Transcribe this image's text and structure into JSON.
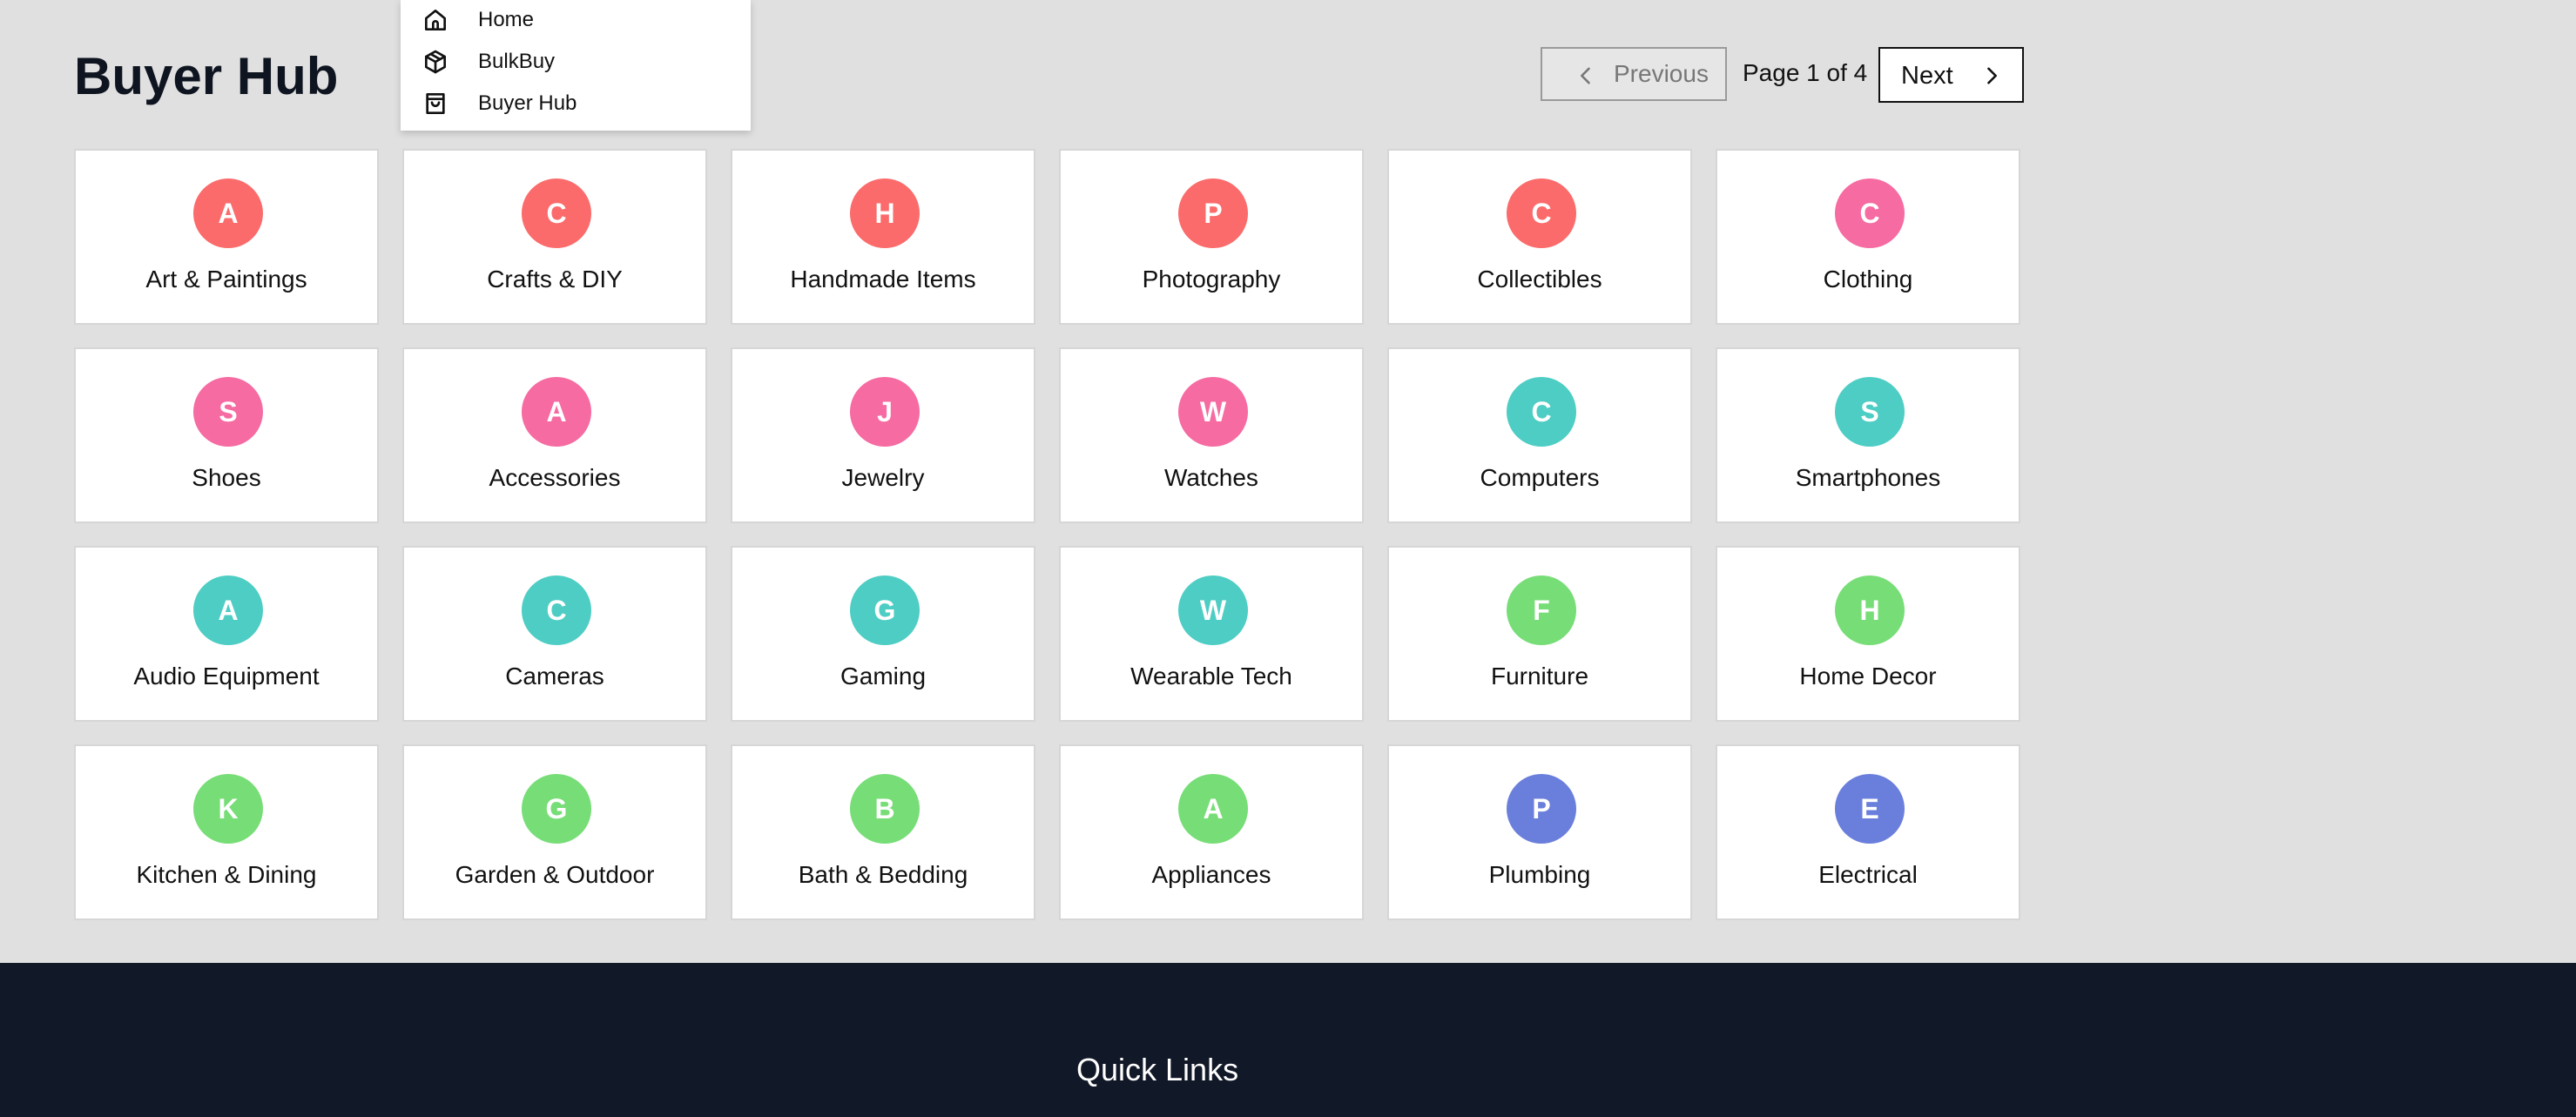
{
  "page": {
    "title": "Buyer Hub"
  },
  "nav_menu": {
    "items": [
      {
        "label": "Home",
        "icon": "home-icon"
      },
      {
        "label": "BulkBuy",
        "icon": "box-icon"
      },
      {
        "label": "Buyer Hub",
        "icon": "shopping-bag-icon"
      }
    ]
  },
  "pagination": {
    "previous_label": "Previous",
    "page_info": "Page 1 of 4",
    "next_label": "Next",
    "current_page": 1,
    "total_pages": 4
  },
  "colors": {
    "red": "#fb6b6b",
    "pink": "#f56ba2",
    "teal": "#4ecdc4",
    "green": "#77dd77",
    "indigo": "#6a7fdb",
    "footer": "#111827"
  },
  "categories": [
    {
      "initial": "A",
      "name": "Art & Paintings",
      "color": "#fb6b6b"
    },
    {
      "initial": "C",
      "name": "Crafts & DIY",
      "color": "#fb6b6b"
    },
    {
      "initial": "H",
      "name": "Handmade Items",
      "color": "#fb6b6b"
    },
    {
      "initial": "P",
      "name": "Photography",
      "color": "#fb6b6b"
    },
    {
      "initial": "C",
      "name": "Collectibles",
      "color": "#fb6b6b"
    },
    {
      "initial": "C",
      "name": "Clothing",
      "color": "#f56ba2"
    },
    {
      "initial": "S",
      "name": "Shoes",
      "color": "#f56ba2"
    },
    {
      "initial": "A",
      "name": "Accessories",
      "color": "#f56ba2"
    },
    {
      "initial": "J",
      "name": "Jewelry",
      "color": "#f56ba2"
    },
    {
      "initial": "W",
      "name": "Watches",
      "color": "#f56ba2"
    },
    {
      "initial": "C",
      "name": "Computers",
      "color": "#4ecdc4"
    },
    {
      "initial": "S",
      "name": "Smartphones",
      "color": "#4ecdc4"
    },
    {
      "initial": "A",
      "name": "Audio Equipment",
      "color": "#4ecdc4"
    },
    {
      "initial": "C",
      "name": "Cameras",
      "color": "#4ecdc4"
    },
    {
      "initial": "G",
      "name": "Gaming",
      "color": "#4ecdc4"
    },
    {
      "initial": "W",
      "name": "Wearable Tech",
      "color": "#4ecdc4"
    },
    {
      "initial": "F",
      "name": "Furniture",
      "color": "#77dd77"
    },
    {
      "initial": "H",
      "name": "Home Decor",
      "color": "#77dd77"
    },
    {
      "initial": "K",
      "name": "Kitchen & Dining",
      "color": "#77dd77"
    },
    {
      "initial": "G",
      "name": "Garden & Outdoor",
      "color": "#77dd77"
    },
    {
      "initial": "B",
      "name": "Bath & Bedding",
      "color": "#77dd77"
    },
    {
      "initial": "A",
      "name": "Appliances",
      "color": "#77dd77"
    },
    {
      "initial": "P",
      "name": "Plumbing",
      "color": "#6a7fdb"
    },
    {
      "initial": "E",
      "name": "Electrical",
      "color": "#6a7fdb"
    }
  ],
  "footer": {
    "heading": "Quick Links"
  }
}
